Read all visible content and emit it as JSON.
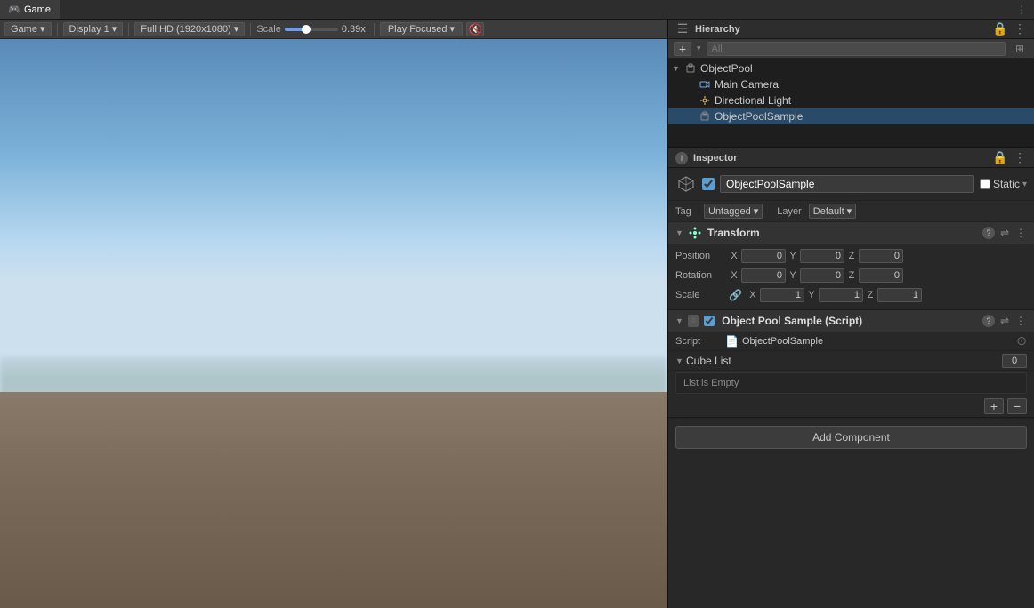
{
  "topTabs": {
    "gameTab": {
      "label": "Game",
      "icon": "🎮",
      "active": true
    },
    "hierarchyTab": {
      "label": "Hierarchy",
      "icon": "☰"
    }
  },
  "gameToolbar": {
    "gameDropdown": "Game",
    "displayDropdown": "Display 1",
    "resolutionDropdown": "Full HD (1920x1080)",
    "scaleLabel": "Scale",
    "scaleValue": "0.39x",
    "focusedPlayLabel": "Play Focused",
    "focusedPlayIcon": "▶",
    "muteIcon": "🔇"
  },
  "hierarchy": {
    "title": "Hierarchy",
    "searchPlaceholder": "All",
    "items": [
      {
        "label": "ObjectPool",
        "indent": 0,
        "expanded": true,
        "icon": "cube"
      },
      {
        "label": "Main Camera",
        "indent": 1,
        "icon": "camera"
      },
      {
        "label": "Directional Light",
        "indent": 1,
        "icon": "light"
      },
      {
        "label": "ObjectPoolSample",
        "indent": 1,
        "icon": "cube",
        "selected": true
      }
    ]
  },
  "inspector": {
    "title": "Inspector",
    "infoIcon": "i",
    "objectName": "ObjectPoolSample",
    "enabledChecked": true,
    "staticLabel": "Static",
    "staticChecked": false,
    "tagLabel": "Tag",
    "tagValue": "Untagged",
    "layerLabel": "Layer",
    "layerValue": "Default",
    "transform": {
      "title": "Transform",
      "icon": "⚙",
      "position": {
        "label": "Position",
        "x": "0",
        "y": "0",
        "z": "0"
      },
      "rotation": {
        "label": "Rotation",
        "x": "0",
        "y": "0",
        "z": "0"
      },
      "scale": {
        "label": "Scale",
        "x": "1",
        "y": "1",
        "z": "1"
      }
    },
    "script": {
      "title": "Object Pool Sample (Script)",
      "scriptLabel": "Script",
      "scriptName": "ObjectPoolSample",
      "checkEnabled": true
    },
    "cubeList": {
      "label": "Cube List",
      "count": "0",
      "listEmptyText": "List is Empty",
      "addBtnLabel": "+",
      "removeBtnLabel": "−"
    },
    "addComponentLabel": "Add Component"
  }
}
